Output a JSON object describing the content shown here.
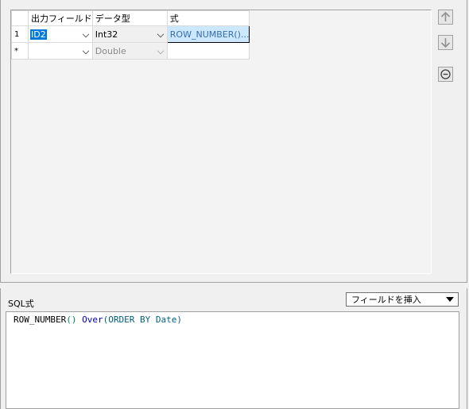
{
  "grid": {
    "headers": [
      "出力フィールド",
      "データ型",
      "式"
    ],
    "rows": [
      {
        "row_num": "1",
        "field": "ID2",
        "type": "Int32",
        "expression": "ROW_NUMBER()..."
      },
      {
        "row_num": "*",
        "field": "",
        "type": "Double",
        "expression": ""
      }
    ]
  },
  "side_buttons": {
    "move_up_icon": "arrow-up",
    "move_down_icon": "arrow-down",
    "remove_icon": "minus-circle"
  },
  "sql": {
    "label": "SQL式",
    "insert_field_dropdown": "フィールドを挿入",
    "expression_parts": {
      "func": "ROW_NUMBER",
      "paren": "()",
      "over": "Over",
      "rest": "(ORDER BY Date)"
    }
  },
  "colors": {
    "selection": "#0078d7",
    "expr_cell_bg": "#cce8ff",
    "sql_keyword_green": "#008060",
    "sql_keyword_blue": "#0000c0"
  }
}
